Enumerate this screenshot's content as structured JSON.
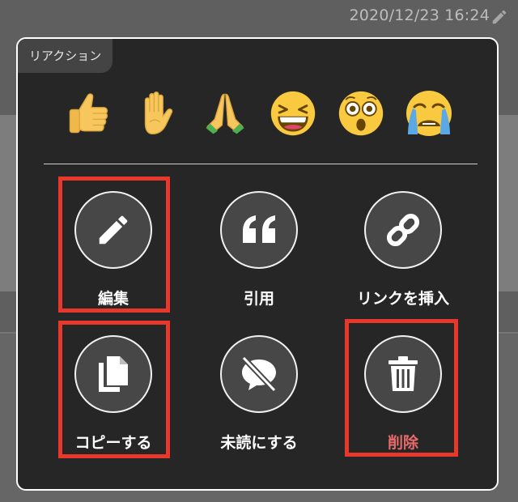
{
  "header": {
    "timestamp": "2020/12/23 16:24",
    "edit_icon": "pencil-icon"
  },
  "panel": {
    "tab_label": "リアクション",
    "reactions": [
      {
        "name": "thumbs-up",
        "icon": "thumbs-up-emoji"
      },
      {
        "name": "raised-hand",
        "icon": "raised-hand-emoji"
      },
      {
        "name": "folded-hands",
        "icon": "folded-hands-emoji"
      },
      {
        "name": "grinning-squinting",
        "icon": "grinning-squinting-face-emoji"
      },
      {
        "name": "astonished",
        "icon": "astonished-face-emoji"
      },
      {
        "name": "crying",
        "icon": "loudly-crying-face-emoji"
      }
    ],
    "actions": {
      "edit": {
        "label": "編集",
        "icon": "pencil-icon",
        "highlighted": true
      },
      "quote": {
        "label": "引用",
        "icon": "quote-icon",
        "highlighted": false
      },
      "insert_link": {
        "label": "リンクを挿入",
        "icon": "link-icon",
        "highlighted": false
      },
      "copy": {
        "label": "コピーする",
        "icon": "copy-icon",
        "highlighted": true
      },
      "mark_unread": {
        "label": "未読にする",
        "icon": "unread-icon",
        "highlighted": false
      },
      "delete": {
        "label": "削除",
        "icon": "trash-icon",
        "highlighted": true
      }
    }
  },
  "colors": {
    "panel_bg": "#262626",
    "highlight": "#e8372b",
    "danger_text": "#e86a6a"
  }
}
